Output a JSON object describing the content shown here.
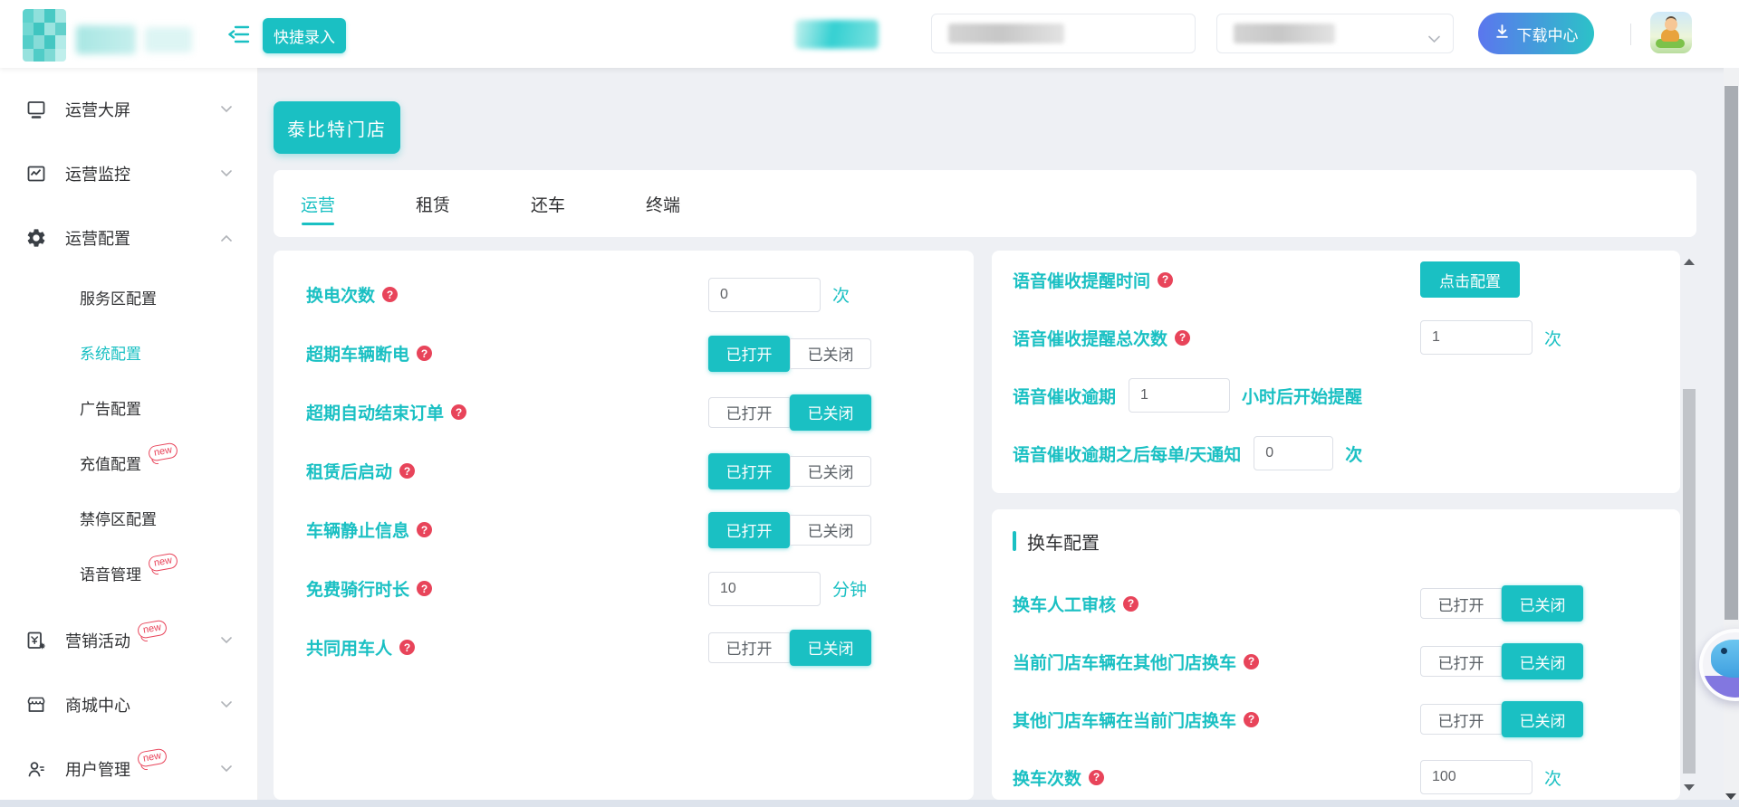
{
  "colors": {
    "accent": "#1ac0c3",
    "danger": "#e8445a",
    "download_gradient_start": "#5b76ee",
    "download_gradient_end": "#2cc2c8",
    "page_bg": "#eef0f4",
    "text_dark": "#303133"
  },
  "header": {
    "quick_entry_label": "快捷录入",
    "download_center_label": "下载中心"
  },
  "sidebar": {
    "items": [
      {
        "label": "运营大屏",
        "icon": "monitor-icon",
        "chevron": "down"
      },
      {
        "label": "运营监控",
        "icon": "chart-icon",
        "chevron": "down"
      },
      {
        "label": "运营配置",
        "icon": "gear-icon",
        "chevron": "up",
        "expanded": true
      },
      {
        "label": "营销活动",
        "icon": "marketing-icon",
        "chevron": "down",
        "badge": "new"
      },
      {
        "label": "商城中心",
        "icon": "mall-icon",
        "chevron": "down"
      },
      {
        "label": "用户管理",
        "icon": "user-icon",
        "chevron": "down",
        "badge": "new"
      }
    ],
    "submenu": [
      {
        "label": "服务区配置"
      },
      {
        "label": "系统配置",
        "active": true
      },
      {
        "label": "广告配置"
      },
      {
        "label": "充值配置",
        "badge": "new"
      },
      {
        "label": "禁停区配置"
      },
      {
        "label": "语音管理",
        "badge": "new"
      }
    ]
  },
  "main": {
    "store_button_label": "泰比特门店",
    "tabs": [
      {
        "label": "运营",
        "active": true
      },
      {
        "label": "租赁"
      },
      {
        "label": "还车"
      },
      {
        "label": "终端"
      }
    ],
    "help_symbol": "?",
    "toggle_on_label": "已打开",
    "toggle_off_label": "已关闭",
    "left_rows": [
      {
        "label": "换电次数",
        "type": "input",
        "value": "0",
        "suffix": "次"
      },
      {
        "label": "超期车辆断电",
        "type": "toggle",
        "state": "on"
      },
      {
        "label": "超期自动结束订单",
        "type": "toggle",
        "state": "off"
      },
      {
        "label": "租赁后启动",
        "type": "toggle",
        "state": "on"
      },
      {
        "label": "车辆静止信息",
        "type": "toggle",
        "state": "on"
      },
      {
        "label": "免费骑行时长",
        "type": "input",
        "value": "10",
        "suffix": "分钟"
      },
      {
        "label": "共同用车人",
        "type": "toggle",
        "state": "off"
      }
    ],
    "voice_rows": [
      {
        "label": "语音催收提醒时间",
        "type": "button",
        "button_label": "点击配置"
      },
      {
        "label": "语音催收提醒总次数",
        "type": "input",
        "value": "1",
        "suffix": "次"
      },
      {
        "label": "语音催收逾期",
        "type": "inline_input",
        "value": "1",
        "suffix": "小时后开始提醒"
      },
      {
        "label": "语音催收逾期之后每单/天通知",
        "type": "inline_input",
        "value": "0",
        "suffix": "次"
      }
    ],
    "swap_section": {
      "title": "换车配置",
      "rows": [
        {
          "label": "换车人工审核",
          "type": "toggle",
          "state": "off"
        },
        {
          "label": "当前门店车辆在其他门店换车",
          "type": "toggle",
          "state": "off"
        },
        {
          "label": "其他门店车辆在当前门店换车",
          "type": "toggle",
          "state": "off"
        },
        {
          "label": "换车次数",
          "type": "input",
          "value": "100",
          "suffix": "次"
        }
      ]
    }
  }
}
